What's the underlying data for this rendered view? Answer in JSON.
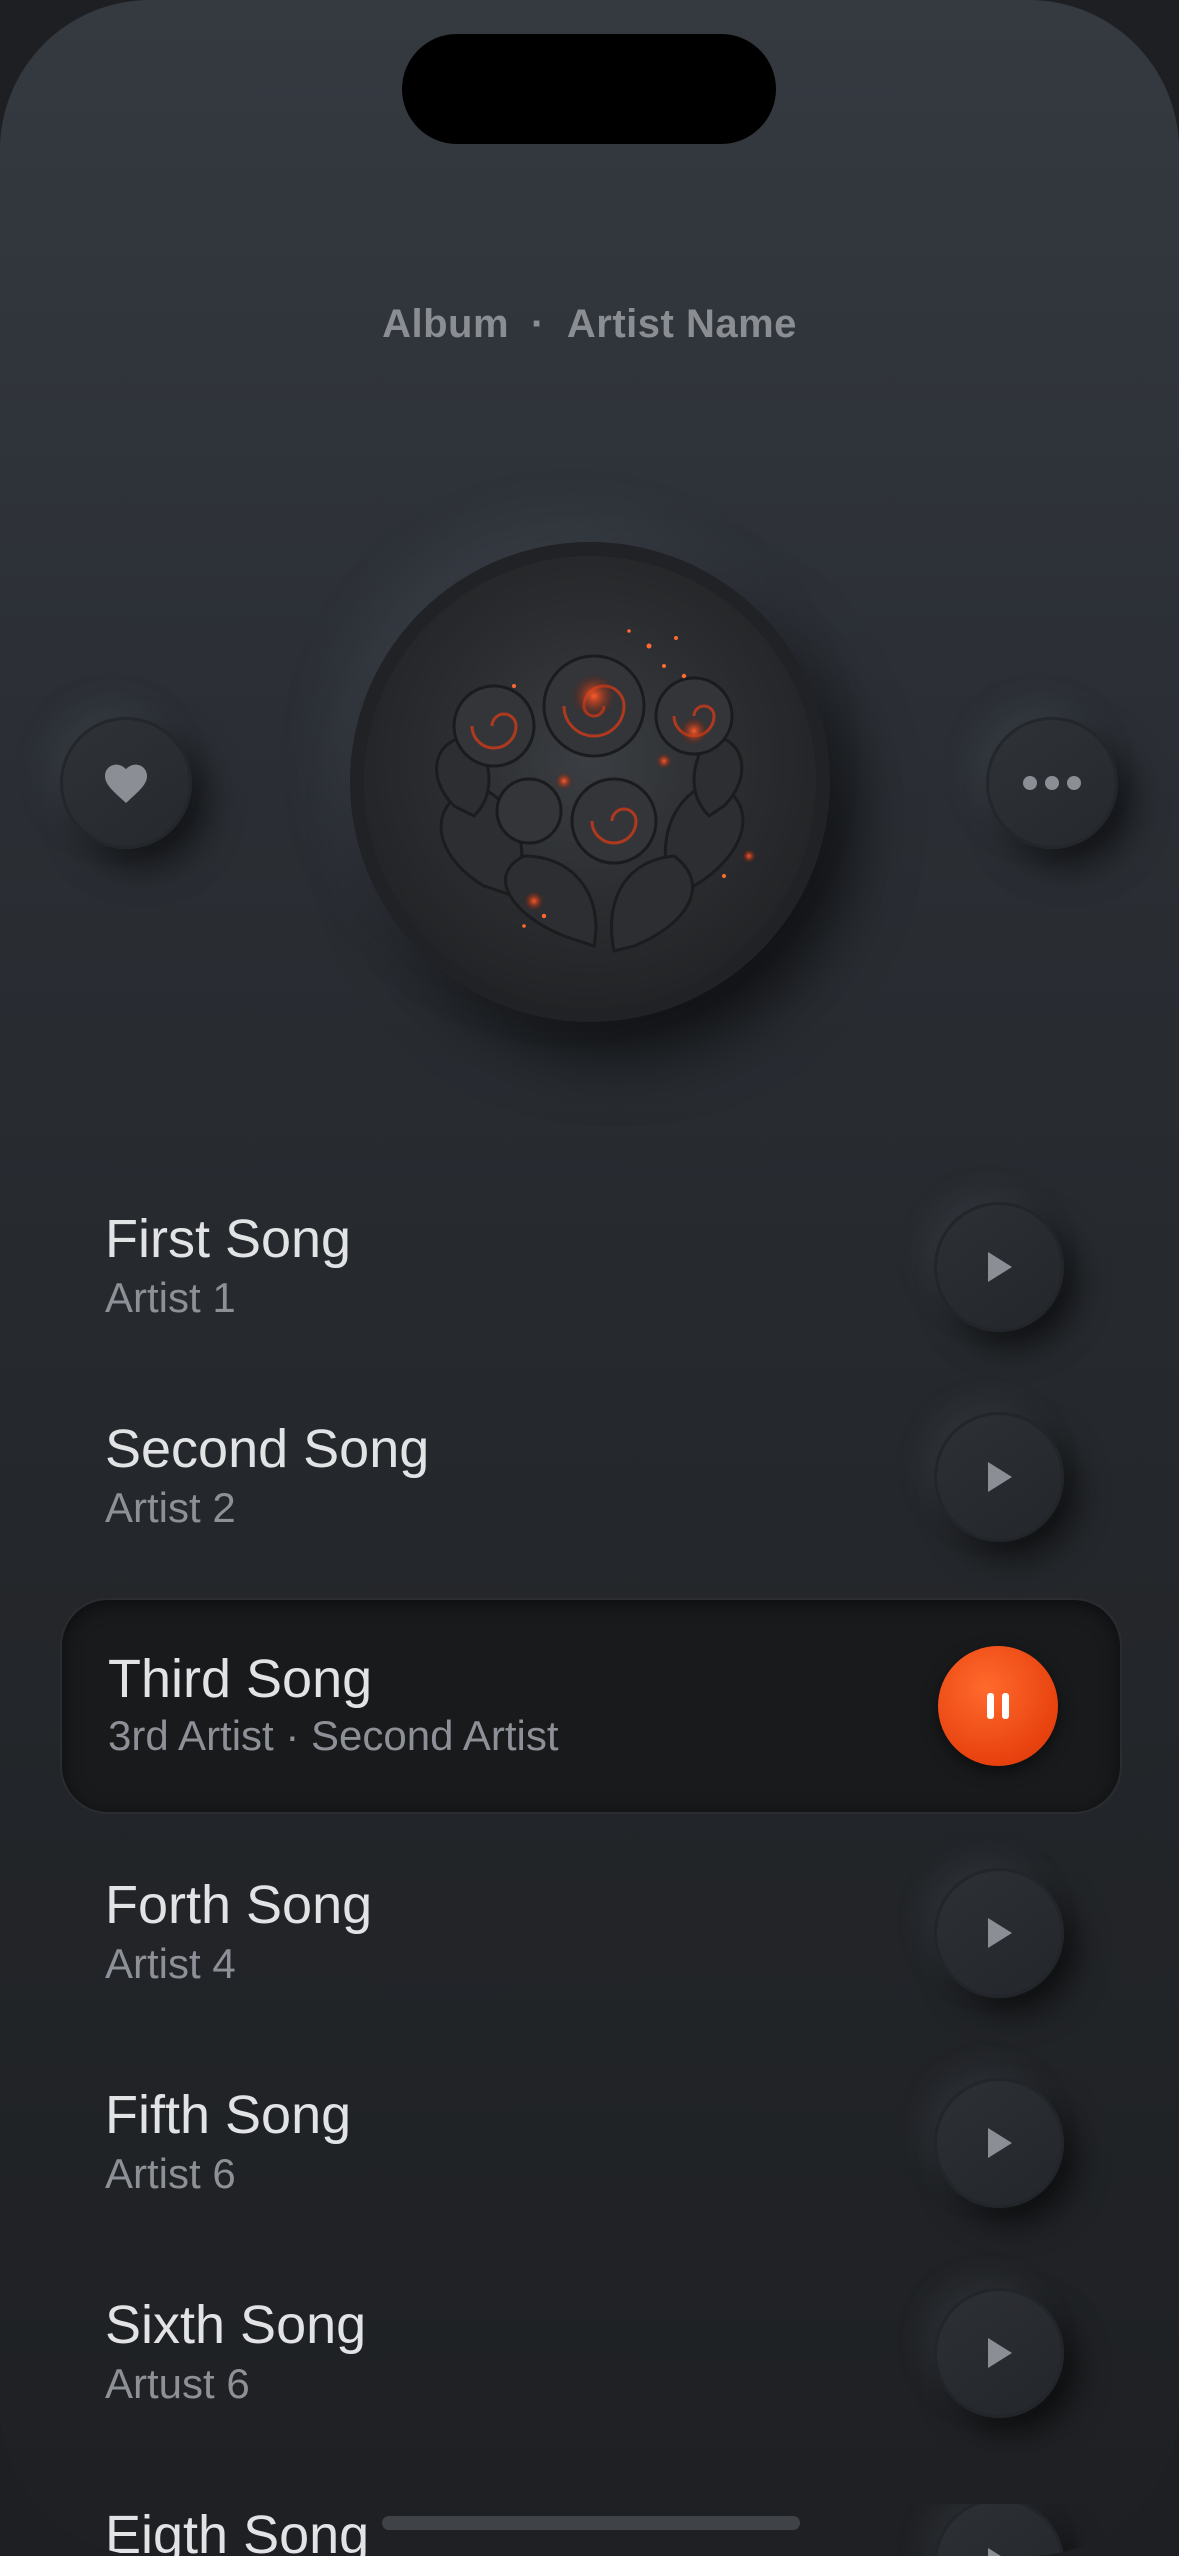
{
  "header": {
    "album": "Album",
    "separator": "·",
    "artist": "Artist Name"
  },
  "buttons": {
    "favorite_icon": "heart-icon",
    "more_icon": "more-icon"
  },
  "songs": [
    {
      "title": "First Song",
      "artist": "Artist 1",
      "state": "play"
    },
    {
      "title": "Second Song",
      "artist": "Artist 2",
      "state": "play"
    },
    {
      "title": "Third Song",
      "artist": "3rd Artist · Second Artist",
      "state": "pause"
    },
    {
      "title": "Forth Song",
      "artist": "Artist 4",
      "state": "play"
    },
    {
      "title": "Fifth Song",
      "artist": "Artist 6",
      "state": "play"
    },
    {
      "title": "Sixth Song",
      "artist": "Artust 6",
      "state": "play"
    },
    {
      "title": "Eigth Song",
      "artist": "",
      "state": "play"
    }
  ],
  "colors": {
    "accent": "#e8420f",
    "background": "#2b2f35",
    "text_primary": "#e2e3e5",
    "text_secondary": "#8d9096"
  }
}
